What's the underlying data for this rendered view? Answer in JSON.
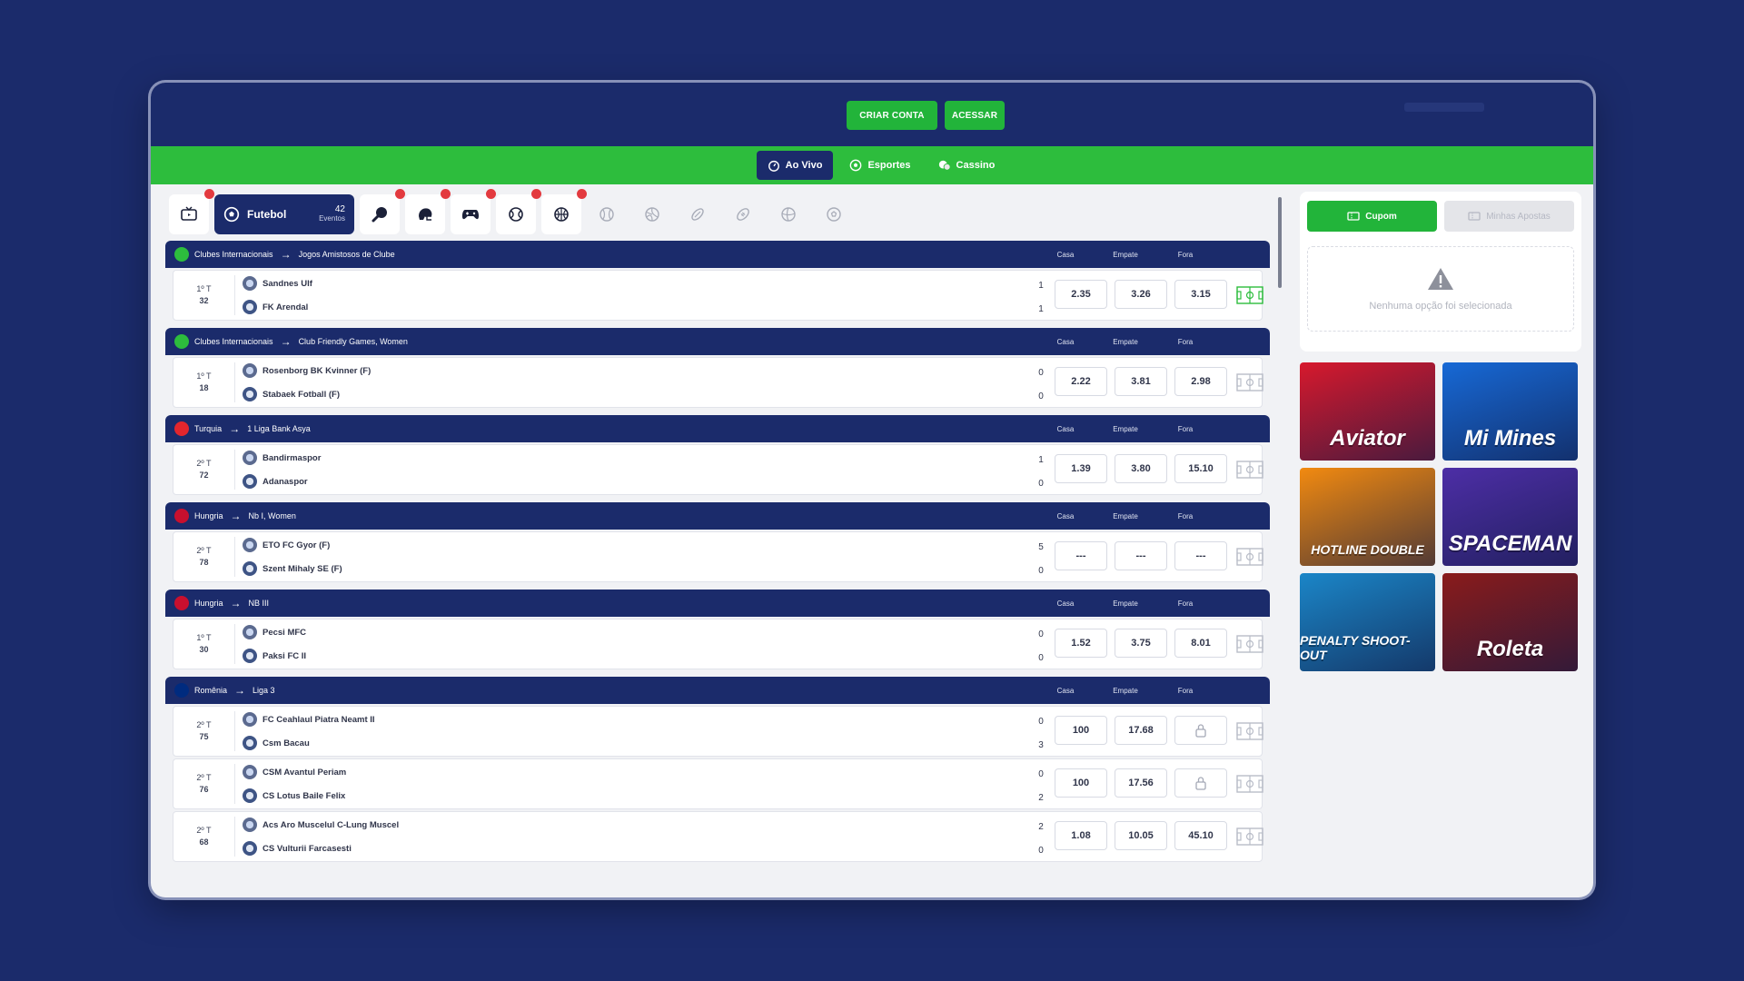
{
  "header": {
    "create_account": "CRIAR CONTA",
    "login": "ACESSAR"
  },
  "nav": [
    {
      "label": "Ao Vivo",
      "icon": "stopwatch-icon",
      "active": true
    },
    {
      "label": "Esportes",
      "icon": "soccer-ball-icon",
      "active": false
    },
    {
      "label": "Cassino",
      "icon": "casino-chips-icon",
      "active": false
    }
  ],
  "sports_bar": {
    "active": {
      "name": "Futebol",
      "count": "42",
      "count_label": "Eventos"
    }
  },
  "columns": {
    "home": "Casa",
    "draw": "Empate",
    "away": "Fora"
  },
  "leagues": [
    {
      "country": "Clubes Internacionais",
      "league": "Jogos Amistosos de Clube",
      "flag": "#2dbd3d",
      "matches": [
        {
          "period": "1º T",
          "minute": "32",
          "home": "Sandnes Ulf",
          "away": "FK Arendal",
          "home_score": "1",
          "away_score": "1",
          "odds": [
            "2.35",
            "3.26",
            "3.15"
          ],
          "pitch_active": true
        }
      ]
    },
    {
      "country": "Clubes Internacionais",
      "league": "Club Friendly Games, Women",
      "flag": "#2dbd3d",
      "matches": [
        {
          "period": "1º T",
          "minute": "18",
          "home": "Rosenborg BK Kvinner (F)",
          "away": "Stabaek Fotball (F)",
          "home_score": "0",
          "away_score": "0",
          "odds": [
            "2.22",
            "3.81",
            "2.98"
          ],
          "pitch_active": false
        }
      ]
    },
    {
      "country": "Turquia",
      "league": "1 Liga Bank Asya",
      "flag": "#e3262d",
      "matches": [
        {
          "period": "2º T",
          "minute": "72",
          "home": "Bandirmaspor",
          "away": "Adanaspor",
          "home_score": "1",
          "away_score": "0",
          "odds": [
            "1.39",
            "3.80",
            "15.10"
          ],
          "pitch_active": false
        }
      ]
    },
    {
      "country": "Hungria",
      "league": "Nb I, Women",
      "flag": "#c8102e",
      "matches": [
        {
          "period": "2º T",
          "minute": "78",
          "home": "ETO FC Gyor (F)",
          "away": "Szent Mihaly SE (F)",
          "home_score": "5",
          "away_score": "0",
          "odds": [
            "---",
            "---",
            "---"
          ],
          "pitch_active": false
        }
      ]
    },
    {
      "country": "Hungria",
      "league": "NB III",
      "flag": "#c8102e",
      "matches": [
        {
          "period": "1º T",
          "minute": "30",
          "home": "Pecsi MFC",
          "away": "Paksi FC II",
          "home_score": "0",
          "away_score": "0",
          "odds": [
            "1.52",
            "3.75",
            "8.01"
          ],
          "pitch_active": false
        }
      ]
    },
    {
      "country": "Romênia",
      "league": "Liga 3",
      "flag": "#002b7f",
      "matches": [
        {
          "period": "2º T",
          "minute": "75",
          "home": "FC Ceahlaul Piatra Neamt II",
          "away": "Csm Bacau",
          "home_score": "0",
          "away_score": "3",
          "odds": [
            "100",
            "17.68",
            "lock"
          ],
          "pitch_active": false
        },
        {
          "period": "2º T",
          "minute": "76",
          "home": "CSM Avantul Periam",
          "away": "CS Lotus Baile Felix",
          "home_score": "0",
          "away_score": "2",
          "odds": [
            "100",
            "17.56",
            "lock"
          ],
          "pitch_active": false
        },
        {
          "period": "2º T",
          "minute": "68",
          "home": "Acs Aro Muscelul C-Lung Muscel",
          "away": "CS Vulturii Farcasesti",
          "home_score": "2",
          "away_score": "0",
          "odds": [
            "1.08",
            "10.05",
            "45.10"
          ],
          "pitch_active": false
        }
      ]
    }
  ],
  "betslip": {
    "tab_coupon": "Cupom",
    "tab_my_bets": "Minhas Apostas",
    "empty_message": "Nenhuma opção foi selecionada"
  },
  "games": [
    {
      "name": "Aviator",
      "bg": "#d7192d"
    },
    {
      "name": "Mi Mines",
      "bg": "#1769d6"
    },
    {
      "name": "HOTLINE DOUBLE",
      "bg": "#f28a10"
    },
    {
      "name": "SPACEMAN",
      "bg": "#4d2ea6"
    },
    {
      "name": "PENALTY SHOOT-OUT",
      "bg": "#1b86c8"
    },
    {
      "name": "Roleta",
      "bg": "#8a1b1b"
    }
  ]
}
